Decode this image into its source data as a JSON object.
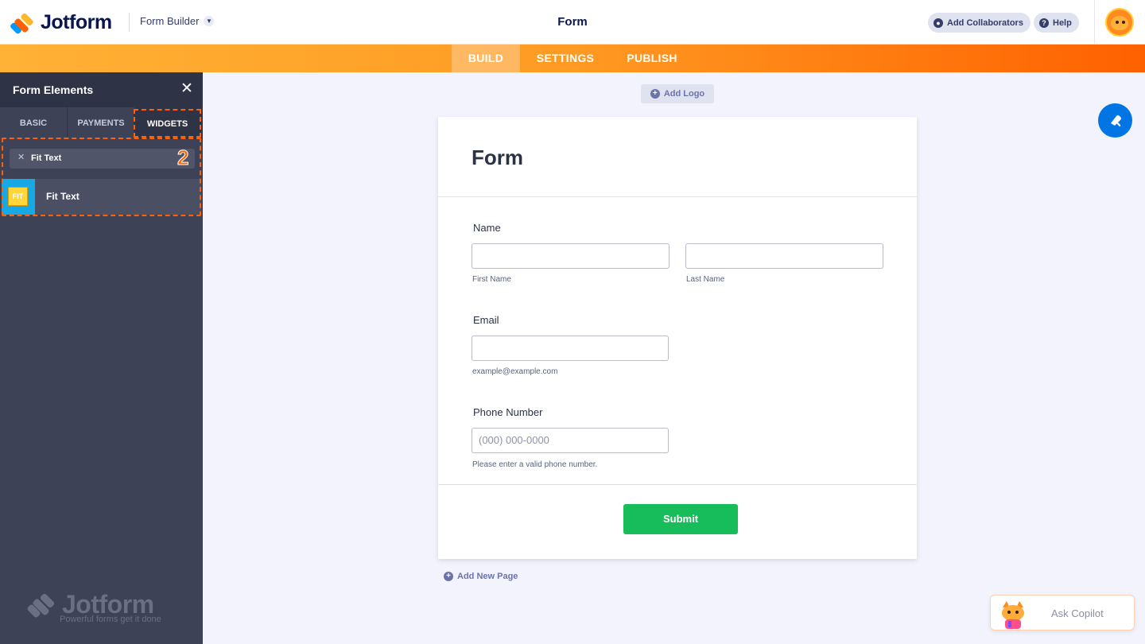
{
  "header": {
    "brand": "Jotform",
    "builder_label": "Form Builder",
    "title": "Form",
    "collaborators_label": "Add Collaborators",
    "help_label": "Help"
  },
  "nav": {
    "tabs": [
      {
        "label": "BUILD",
        "active": true
      },
      {
        "label": "SETTINGS",
        "active": false
      },
      {
        "label": "PUBLISH",
        "active": false
      }
    ]
  },
  "sidebar": {
    "title": "Form Elements",
    "tabs": [
      {
        "label": "BASIC",
        "active": false
      },
      {
        "label": "PAYMENTS",
        "active": false
      },
      {
        "label": "WIDGETS",
        "active": true
      }
    ],
    "search_value": "Fit Text",
    "step_badge": "2",
    "results": [
      {
        "name": "Fit Text",
        "thumb_text": "FIT"
      }
    ],
    "brand_name": "Jotform",
    "brand_tagline": "Powerful forms get it done"
  },
  "canvas": {
    "add_logo_label": "Add Logo",
    "add_page_label": "Add New Page"
  },
  "form": {
    "heading": "Form",
    "name_label": "Name",
    "first_name_sub": "First Name",
    "last_name_sub": "Last Name",
    "email_label": "Email",
    "email_sub": "example@example.com",
    "phone_label": "Phone Number",
    "phone_placeholder": "(000) 000-0000",
    "phone_sub": "Please enter a valid phone number.",
    "submit_label": "Submit"
  },
  "copilot": {
    "label": "Ask Copilot"
  },
  "colors": {
    "accent_orange": "#ff6100",
    "sidebar_bg": "#3e4256",
    "submit_green": "#18bd5b",
    "designer_blue": "#0075e3",
    "brand_navy": "#0a1551"
  }
}
